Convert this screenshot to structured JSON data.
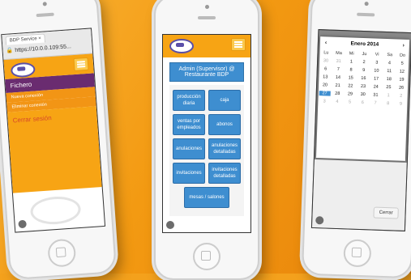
{
  "colors": {
    "accent": "#f7a414",
    "button_blue": "#3e8ed0",
    "menu_purple": "#6a2c70"
  },
  "phone1": {
    "tab_title": "BDP Service",
    "url": "https://10.0.0.109:55...",
    "menu": {
      "section": "Fichero",
      "items": [
        "Nueva conexión",
        "Eliminar conexión"
      ],
      "logout": "Cerrar sesión"
    }
  },
  "phone2": {
    "title": "Admin (Supervisor) @ Restaurante BDP",
    "buttons": {
      "produccion": "producción diaria",
      "caja": "caja",
      "ventas": "ventas por empleados",
      "abonos": "abonos",
      "anulaciones": "anulaciones",
      "anulaciones_det": "anulaciones detalladas",
      "invitaciones": "invitaciones",
      "invitaciones_det": "invitaciones detalladas",
      "mesas": "mesas / salones"
    }
  },
  "phone3": {
    "month": "Enero 2014",
    "prev": "‹",
    "next": "›",
    "days": [
      "Lu",
      "Ma",
      "Mi",
      "Ju",
      "Vi",
      "Sa",
      "Do"
    ],
    "weeks": [
      [
        "30",
        "31",
        "1",
        "2",
        "3",
        "4",
        "5"
      ],
      [
        "6",
        "7",
        "8",
        "9",
        "10",
        "11",
        "12"
      ],
      [
        "13",
        "14",
        "15",
        "16",
        "17",
        "18",
        "19"
      ],
      [
        "20",
        "21",
        "22",
        "23",
        "24",
        "25",
        "26"
      ],
      [
        "27",
        "28",
        "29",
        "30",
        "31",
        "1",
        "2"
      ],
      [
        "3",
        "4",
        "5",
        "6",
        "7",
        "8",
        "9"
      ]
    ],
    "selected": "27",
    "close": "Cerrar"
  }
}
